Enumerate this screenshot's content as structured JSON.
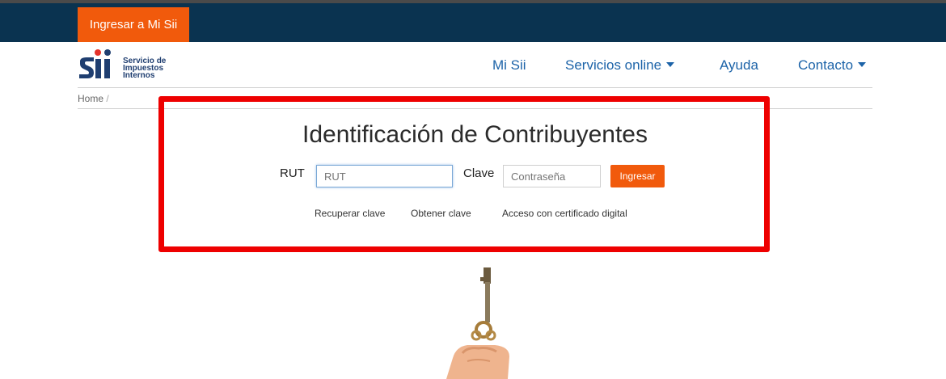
{
  "topbar": {
    "login_label": "Ingresar a Mi Sii"
  },
  "logo": {
    "mark": "Sii",
    "line1": "Servicio de",
    "line2": "Impuestos",
    "line3": "Internos"
  },
  "nav": {
    "items": [
      {
        "label": "Mi Sii"
      },
      {
        "label": "Servicios online"
      },
      {
        "label": "Ayuda"
      },
      {
        "label": "Contacto"
      }
    ]
  },
  "breadcrumb": {
    "home": "Home",
    "separator": "/"
  },
  "form": {
    "title": "Identificación de Contribuyentes",
    "rut_label": "RUT",
    "rut_placeholder": "RUT",
    "clave_label": "Clave",
    "clave_placeholder": "Contraseña",
    "submit_label": "Ingresar"
  },
  "links": {
    "recover": "Recuperar clave",
    "obtain": "Obtener clave",
    "certificate": "Acceso con certificado digital"
  },
  "colors": {
    "accent": "#f15a0c",
    "topbar": "#0a3350",
    "nav_link": "#1c63a8",
    "highlight": "#ee0000"
  }
}
